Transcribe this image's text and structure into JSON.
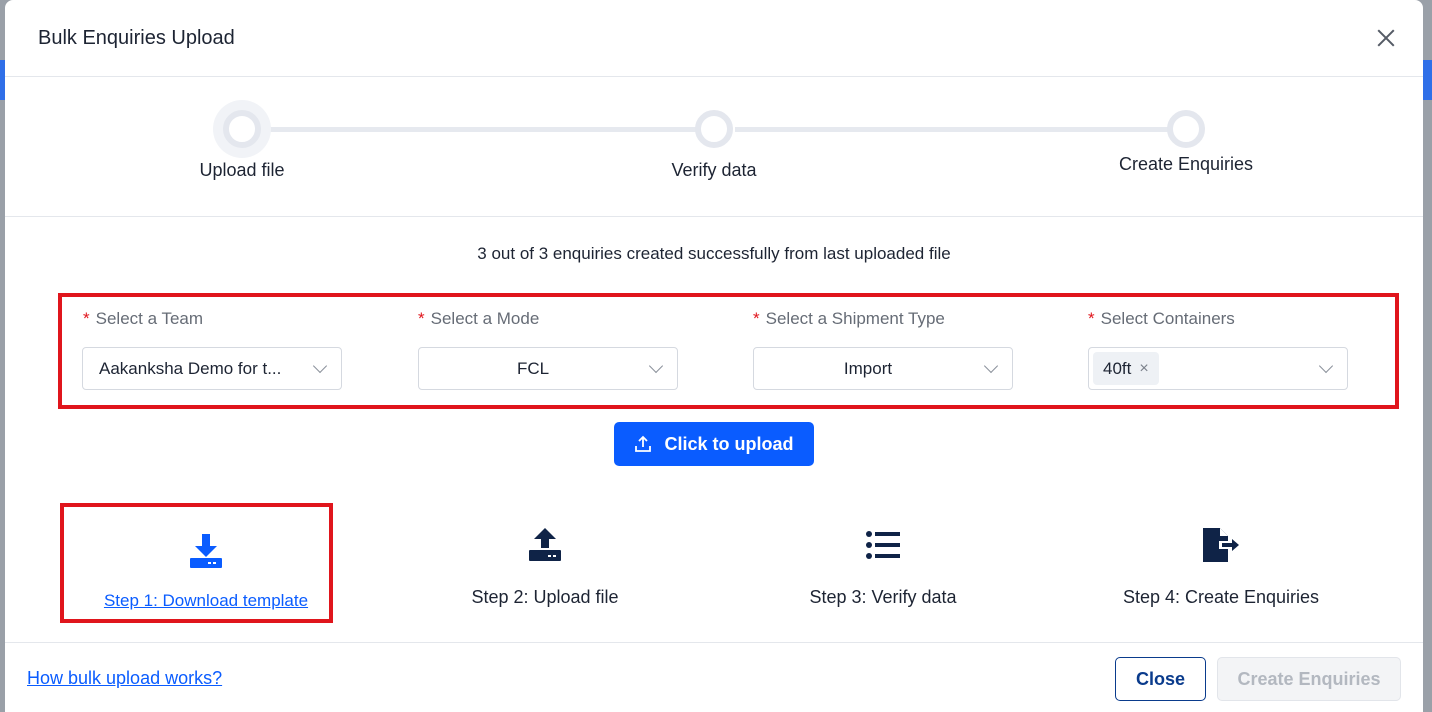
{
  "modal": {
    "title": "Bulk Enquiries Upload"
  },
  "stepper": {
    "steps": [
      {
        "label": "Upload file"
      },
      {
        "label": "Verify data"
      },
      {
        "label": "Create Enquiries"
      }
    ]
  },
  "status_message": "3 out of 3 enquiries created successfully from last uploaded file",
  "fields": {
    "team": {
      "label": "Select a Team",
      "value": "Aakanksha Demo for t..."
    },
    "mode": {
      "label": "Select a Mode",
      "value": "FCL"
    },
    "shipment_type": {
      "label": "Select a Shipment Type",
      "value": "Import"
    },
    "containers": {
      "label": "Select Containers",
      "tags": [
        "40ft"
      ]
    }
  },
  "required_marker": "*",
  "upload_button": {
    "label": "Click to upload"
  },
  "steps": [
    {
      "label": "Step 1: Download template",
      "icon": "download-icon"
    },
    {
      "label": "Step 2: Upload file",
      "icon": "upload-tray-icon"
    },
    {
      "label": "Step 3: Verify data",
      "icon": "list-icon"
    },
    {
      "label": "Step 4: Create Enquiries",
      "icon": "file-export-icon"
    }
  ],
  "footer": {
    "help_link": "How bulk upload works?",
    "close_label": "Close",
    "create_label": "Create Enquiries"
  },
  "colors": {
    "primary": "#0a5cff",
    "highlight": "#e0151c",
    "dark_icon": "#0f2347"
  }
}
